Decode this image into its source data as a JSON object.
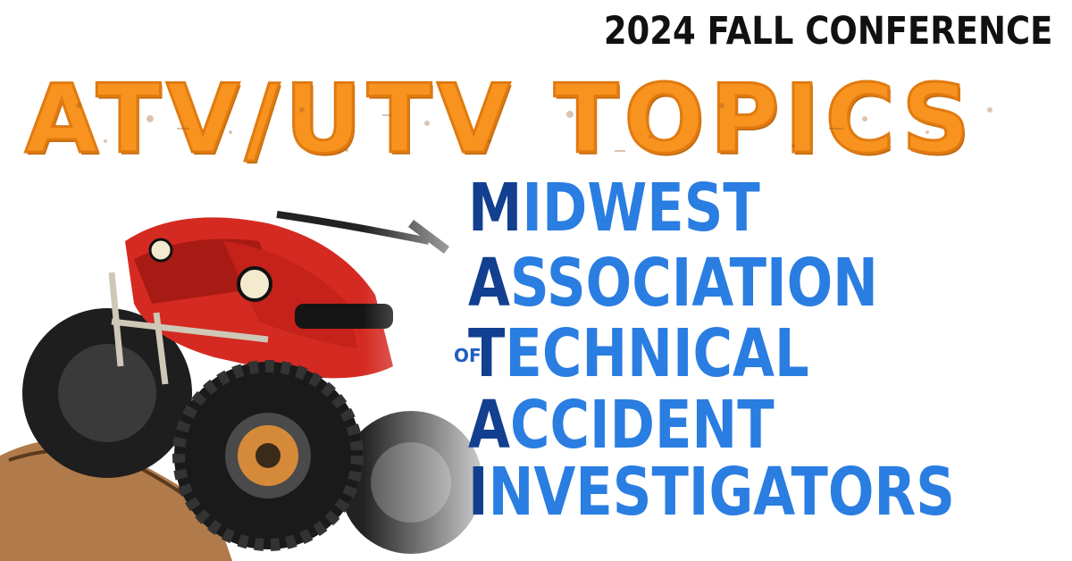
{
  "headline": "2024 FALL CONFERENCE",
  "topic_title": "ATV/UTV TOPICS",
  "organization": {
    "lines": [
      {
        "initial": "M",
        "rest": "IDWEST"
      },
      {
        "initial": "A",
        "rest": "SSOCIATION"
      },
      {
        "initial": "T",
        "rest": "ECHNICAL"
      },
      {
        "initial": "A",
        "rest": "CCIDENT"
      },
      {
        "initial": "I",
        "rest": "NVESTIGATORS"
      }
    ],
    "connector": "OF"
  },
  "colors": {
    "topic_orange": "#f7931e",
    "org_blue": "#2a7de1",
    "org_initial_blue": "#123f8f",
    "atv_red": "#d42a22",
    "headline": "#111111"
  },
  "illustration": "atv-quad-bike"
}
